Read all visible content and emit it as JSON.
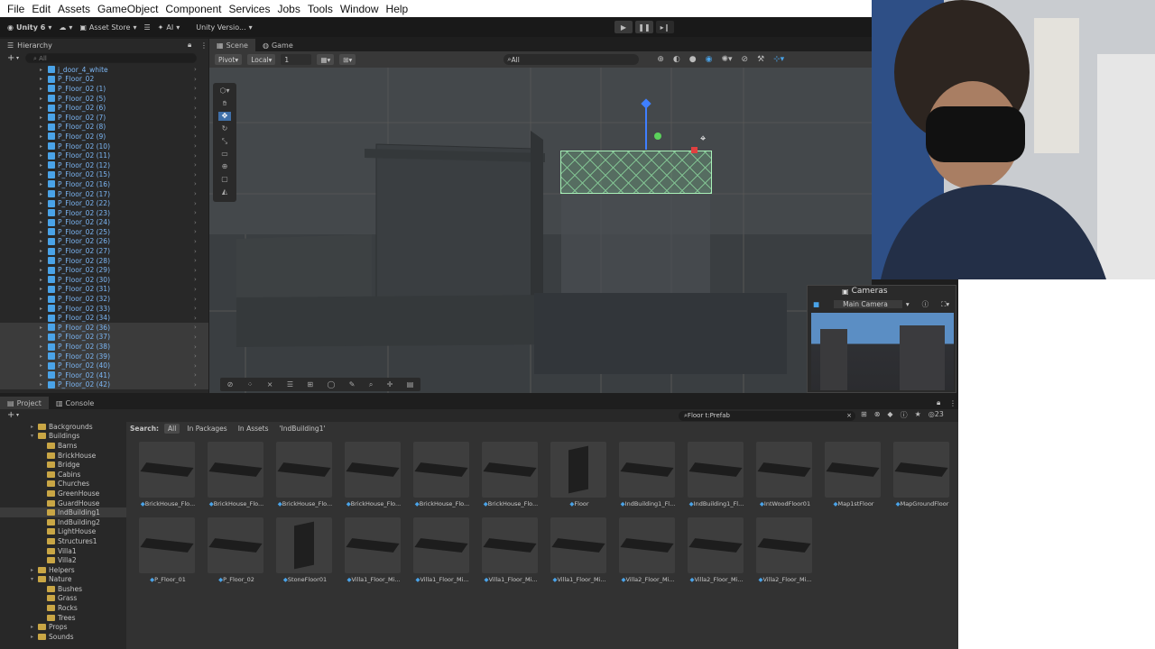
{
  "menubar": {
    "items": [
      "File",
      "Edit",
      "Assets",
      "GameObject",
      "Component",
      "Services",
      "Jobs",
      "Tools",
      "Window",
      "Help"
    ]
  },
  "toolbar": {
    "unity_label": "Unity 6",
    "asset_store": "Asset Store",
    "ai_label": "AI",
    "version_label": "Unity Versio..."
  },
  "hierarchy": {
    "title": "Hierarchy",
    "search_placeholder": "All",
    "rows": [
      "j_door_4_white",
      "P_Floor_02",
      "P_Floor_02 (1)",
      "P_Floor_02 (5)",
      "P_Floor_02 (6)",
      "P_Floor_02 (7)",
      "P_Floor_02 (8)",
      "P_Floor_02 (9)",
      "P_Floor_02 (10)",
      "P_Floor_02 (11)",
      "P_Floor_02 (12)",
      "P_Floor_02 (15)",
      "P_Floor_02 (16)",
      "P_Floor_02 (17)",
      "P_Floor_02 (22)",
      "P_Floor_02 (23)",
      "P_Floor_02 (24)",
      "P_Floor_02 (25)",
      "P_Floor_02 (26)",
      "P_Floor_02 (27)",
      "P_Floor_02 (28)",
      "P_Floor_02 (29)",
      "P_Floor_02 (30)",
      "P_Floor_02 (31)",
      "P_Floor_02 (32)",
      "P_Floor_02 (33)",
      "P_Floor_02 (34)",
      "P_Floor_02 (36)",
      "P_Floor_02 (37)",
      "P_Floor_02 (38)",
      "P_Floor_02 (39)",
      "P_Floor_02 (40)",
      "P_Floor_02 (41)",
      "P_Floor_02 (42)"
    ]
  },
  "scene": {
    "tabs": [
      "Scene",
      "Game"
    ],
    "pivot": "Pivot",
    "local": "Local",
    "grid_value": "1",
    "search_placeholder": "All"
  },
  "cameras": {
    "title": "Cameras",
    "selected": "Main Camera"
  },
  "project": {
    "tabs": [
      "Project",
      "Console"
    ],
    "search_label": "Search:",
    "filters": [
      "All",
      "In Packages",
      "In Assets",
      "'IndBuilding1'"
    ],
    "search_value": "Floor t:Prefab",
    "count": "23",
    "tree": [
      {
        "label": "Backgrounds",
        "indent": 0
      },
      {
        "label": "Buildings",
        "indent": 0,
        "open": true
      },
      {
        "label": "Barns",
        "indent": 1
      },
      {
        "label": "BrickHouse",
        "indent": 1
      },
      {
        "label": "Bridge",
        "indent": 1
      },
      {
        "label": "Cabins",
        "indent": 1
      },
      {
        "label": "Churches",
        "indent": 1
      },
      {
        "label": "GreenHouse",
        "indent": 1
      },
      {
        "label": "GuardHouse",
        "indent": 1
      },
      {
        "label": "IndBuilding1",
        "indent": 1,
        "sel": true
      },
      {
        "label": "IndBuilding2",
        "indent": 1
      },
      {
        "label": "LightHouse",
        "indent": 1
      },
      {
        "label": "Structures1",
        "indent": 1
      },
      {
        "label": "Villa1",
        "indent": 1
      },
      {
        "label": "Villa2",
        "indent": 1
      },
      {
        "label": "Helpers",
        "indent": 0
      },
      {
        "label": "Nature",
        "indent": 0,
        "open": true
      },
      {
        "label": "Bushes",
        "indent": 1
      },
      {
        "label": "Grass",
        "indent": 1
      },
      {
        "label": "Rocks",
        "indent": 1
      },
      {
        "label": "Trees",
        "indent": 1
      },
      {
        "label": "Props",
        "indent": 0
      },
      {
        "label": "Sounds",
        "indent": 0
      }
    ],
    "assets": [
      {
        "name": "BrickHouse_Flo...",
        "kind": "slab"
      },
      {
        "name": "BrickHouse_Flo...",
        "kind": "slab"
      },
      {
        "name": "BrickHouse_Flo...",
        "kind": "slab"
      },
      {
        "name": "BrickHouse_Flo...",
        "kind": "slab"
      },
      {
        "name": "BrickHouse_Flo...",
        "kind": "slab"
      },
      {
        "name": "BrickHouse_Flo...",
        "kind": "slab"
      },
      {
        "name": "Floor",
        "kind": "wall"
      },
      {
        "name": "IndBuilding1_Fl...",
        "kind": "slab"
      },
      {
        "name": "IndBuilding1_Fl...",
        "kind": "slab"
      },
      {
        "name": "IntWoodFloor01",
        "kind": "slab"
      },
      {
        "name": "Map1stFloor",
        "kind": "slab"
      },
      {
        "name": "MapGroundFloor",
        "kind": "slab"
      },
      {
        "name": "P_Floor_01",
        "kind": "slab"
      },
      {
        "name": "P_Floor_02",
        "kind": "slab"
      },
      {
        "name": "StoneFloor01",
        "kind": "wall"
      },
      {
        "name": "Villa1_Floor_Mi...",
        "kind": "slab"
      },
      {
        "name": "Villa1_Floor_Mi...",
        "kind": "slab"
      },
      {
        "name": "Villa1_Floor_Mi...",
        "kind": "slab"
      },
      {
        "name": "Villa1_Floor_Mi...",
        "kind": "slab"
      },
      {
        "name": "Villa2_Floor_Mi...",
        "kind": "slab"
      },
      {
        "name": "Villa2_Floor_Mi...",
        "kind": "slab"
      },
      {
        "name": "Villa2_Floor_Mi...",
        "kind": "slab"
      }
    ]
  }
}
